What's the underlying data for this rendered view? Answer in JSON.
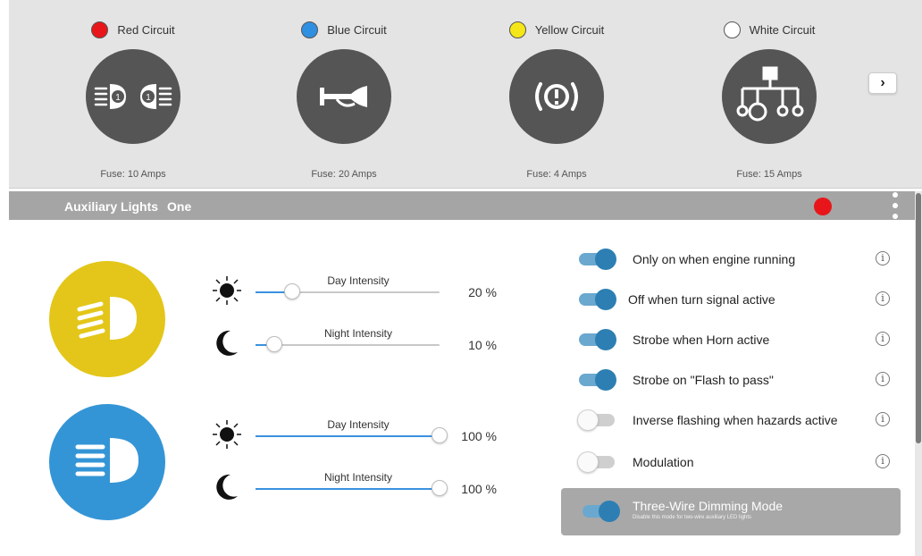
{
  "circuits": [
    {
      "name": "Red Circuit",
      "color": "#e8161a",
      "fuse": "Fuse: 10 Amps",
      "icon": "headlights-icon",
      "badges": [
        "1",
        "1"
      ]
    },
    {
      "name": "Blue Circuit",
      "color": "#2f8fe0",
      "fuse": "Fuse: 20 Amps",
      "icon": "horn-icon"
    },
    {
      "name": "Yellow Circuit",
      "color": "#f5e617",
      "fuse": "Fuse: 4 Amps",
      "icon": "brake-warning-icon",
      "symbol": "(!)"
    },
    {
      "name": "White Circuit",
      "color": "#ffffff",
      "fuse": "Fuse: 15 Amps",
      "icon": "circuit-tree-icon"
    }
  ],
  "next_button": "›",
  "header": {
    "title": "Auxiliary Lights",
    "subtitle": "One",
    "indicator_color": "#e8161a",
    "menu_icon": "kebab-menu-icon"
  },
  "lights": [
    {
      "icon": "auxiliary-light-icon",
      "color": "#e3c619",
      "day": {
        "label": "Day Intensity",
        "value": 20,
        "value_text": "20 %",
        "icon": "sun-icon"
      },
      "night": {
        "label": "Night Intensity",
        "value": 10,
        "value_text": "10 %",
        "icon": "moon-icon"
      }
    },
    {
      "icon": "headlight-icon",
      "color": "#3495d6",
      "day": {
        "label": "Day Intensity",
        "value": 100,
        "value_text": "100 %",
        "icon": "sun-icon"
      },
      "night": {
        "label": "Night Intensity",
        "value": 100,
        "value_text": "100 %",
        "icon": "moon-icon"
      }
    }
  ],
  "options": [
    {
      "label": "Only on when engine running",
      "on": true
    },
    {
      "label": "Off when turn signal active",
      "on": true
    },
    {
      "label": "Strobe when Horn active",
      "on": true
    },
    {
      "label": "Strobe on \"Flash to pass\"",
      "on": true
    },
    {
      "label": "Inverse flashing when hazards active",
      "on": false
    },
    {
      "label": "Modulation",
      "on": false
    }
  ],
  "info_symbol": "i",
  "dimming": {
    "title": "Three-Wire Dimming Mode",
    "subtitle": "Disable this mode for two-wire auxiliary LED lights",
    "on": true
  }
}
